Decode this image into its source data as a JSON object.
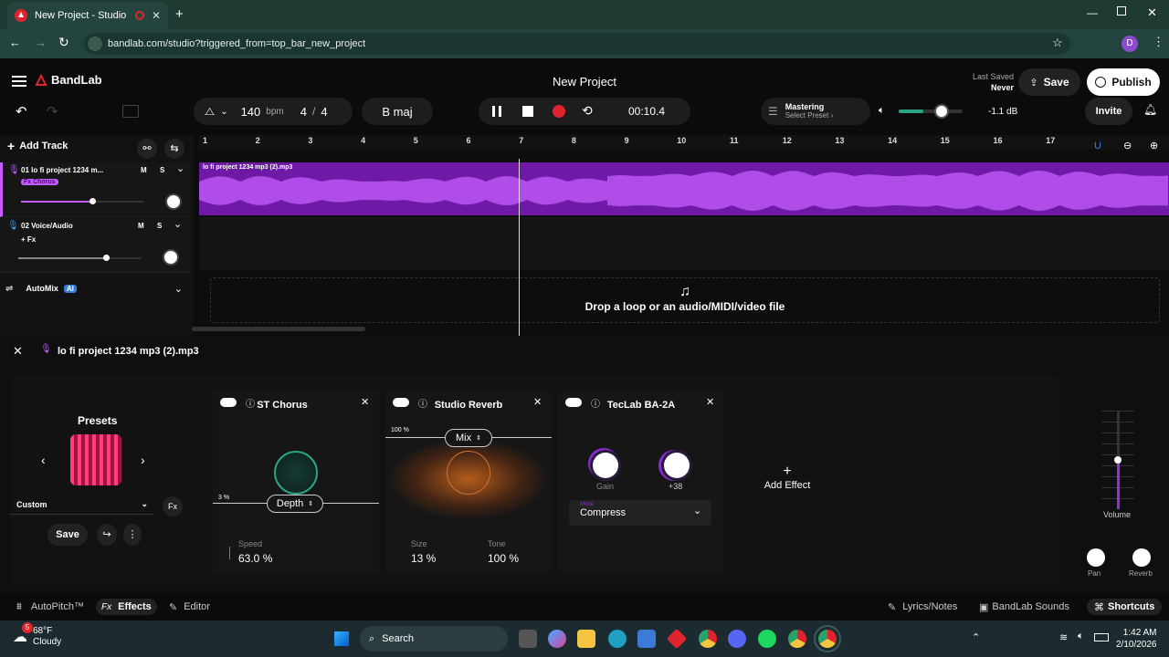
{
  "browser": {
    "tab_title": "New Project - Studio",
    "url": "bandlab.com/studio?triggered_from=top_bar_new_project",
    "profile_initial": "D"
  },
  "header": {
    "logo": "BandLab",
    "project_title": "New Project",
    "last_saved_label": "Last Saved",
    "last_saved_value": "Never",
    "save_label": "Save",
    "publish_label": "Publish"
  },
  "transport": {
    "bpm": "140",
    "bpm_unit": "bpm",
    "time_sig_num": "4",
    "time_sig_sep": "/",
    "time_sig_den": "4",
    "key": "B maj",
    "time": "00:10.4",
    "mastering_label": "Mastering",
    "mastering_sub": "Select Preset ›",
    "master_volume_db": "-1.1 dB",
    "master_volume_level": 0.78,
    "invite_label": "Invite"
  },
  "tracklist": {
    "add_track_label": "Add Track",
    "tracks": [
      {
        "name": "01  lo fi project 1234 m...",
        "fx": "Fx Chorus",
        "mute": "M",
        "solo": "S",
        "volume": 0.58
      },
      {
        "name": "02  Voice/Audio",
        "fx": "+ Fx",
        "mute": "M",
        "solo": "S",
        "volume": 0.72
      }
    ],
    "automix_label": "AutoMix",
    "automix_badge": "AI"
  },
  "ruler": [
    "1",
    "2",
    "3",
    "4",
    "5",
    "6",
    "7",
    "8",
    "9",
    "10",
    "11",
    "12",
    "13",
    "14",
    "15",
    "16",
    "17"
  ],
  "clip": {
    "name": "lo fi project 1234 mp3 (2).mp3"
  },
  "drop_zone": {
    "text": "Drop a loop or an audio/MIDI/video file"
  },
  "fx_panel": {
    "track_name": "lo fi project 1234 mp3 (2).mp3",
    "presets_label": "Presets",
    "preset_value": "Custom",
    "save_label": "Save",
    "add_effect_label": "Add Effect",
    "effects": [
      {
        "name": "ST Chorus",
        "mix_label": "3 %",
        "dropdown": "Depth",
        "param1_label": "Speed",
        "param1_value": "63.0 %"
      },
      {
        "name": "Studio Reverb",
        "mix_label": "100 %",
        "dropdown": "Mix",
        "param1_label": "Size",
        "param1_value": "13 %",
        "param2_label": "Tone",
        "param2_value": "100 %"
      },
      {
        "name": "TecLab BA-2A",
        "knob1_label": "Gain",
        "knob2_label": "+38",
        "mode_label": "Mode",
        "mode_value": "Compress"
      }
    ],
    "volume_label": "Volume",
    "volume_level": 0.5,
    "pan_label": "Pan",
    "reverb_label": "Reverb"
  },
  "bottom_bar": {
    "autopitch": "AutoPitch™",
    "effects": "Effects",
    "editor": "Editor",
    "lyrics": "Lyrics/Notes",
    "sounds": "BandLab Sounds",
    "shortcuts": "Shortcuts"
  },
  "taskbar": {
    "weather_temp": "68°F",
    "weather_desc": "Cloudy",
    "search_placeholder": "Search",
    "time": "1:42 AM",
    "date": "2/10/2026",
    "weather_badge": "5"
  },
  "colors": {
    "clip_purple": "#6e1aa6",
    "waveform": "#c65cff",
    "accent_teal": "#2aa386",
    "record_red": "#e0242e"
  }
}
